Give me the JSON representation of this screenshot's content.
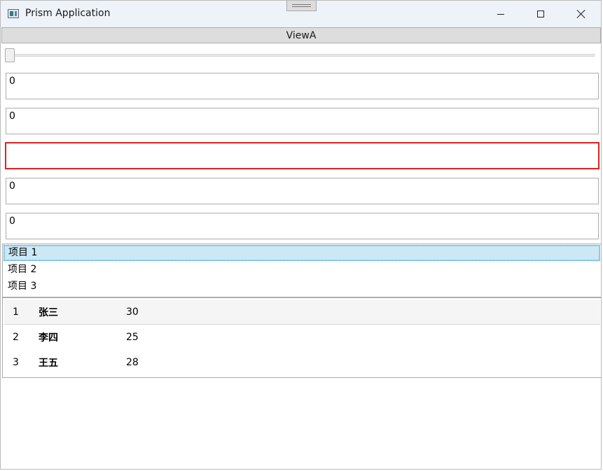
{
  "window": {
    "title": "Prism Application"
  },
  "header": {
    "view_label": "ViewA"
  },
  "slider": {
    "value_fraction": 0
  },
  "textboxes": [
    {
      "value": "0"
    },
    {
      "value": "0"
    },
    {
      "value": ""
    },
    {
      "value": "0"
    },
    {
      "value": "0"
    }
  ],
  "list": {
    "items": [
      {
        "label": "项目 1"
      },
      {
        "label": "项目 2"
      },
      {
        "label": "项目 3"
      }
    ],
    "selected_index": 0
  },
  "table": {
    "rows": [
      {
        "id": "1",
        "name": "张三",
        "age": "30"
      },
      {
        "id": "2",
        "name": "李四",
        "age": "25"
      },
      {
        "id": "3",
        "name": "王五",
        "age": "28"
      }
    ]
  },
  "colors": {
    "error_border": "#e02020",
    "selection_bg": "#cce8f5",
    "titlebar_bg": "#eef2f9"
  },
  "icons": {
    "app": "app-window-icon",
    "minimize": "minimize-icon",
    "maximize": "maximize-icon",
    "close": "close-icon"
  }
}
